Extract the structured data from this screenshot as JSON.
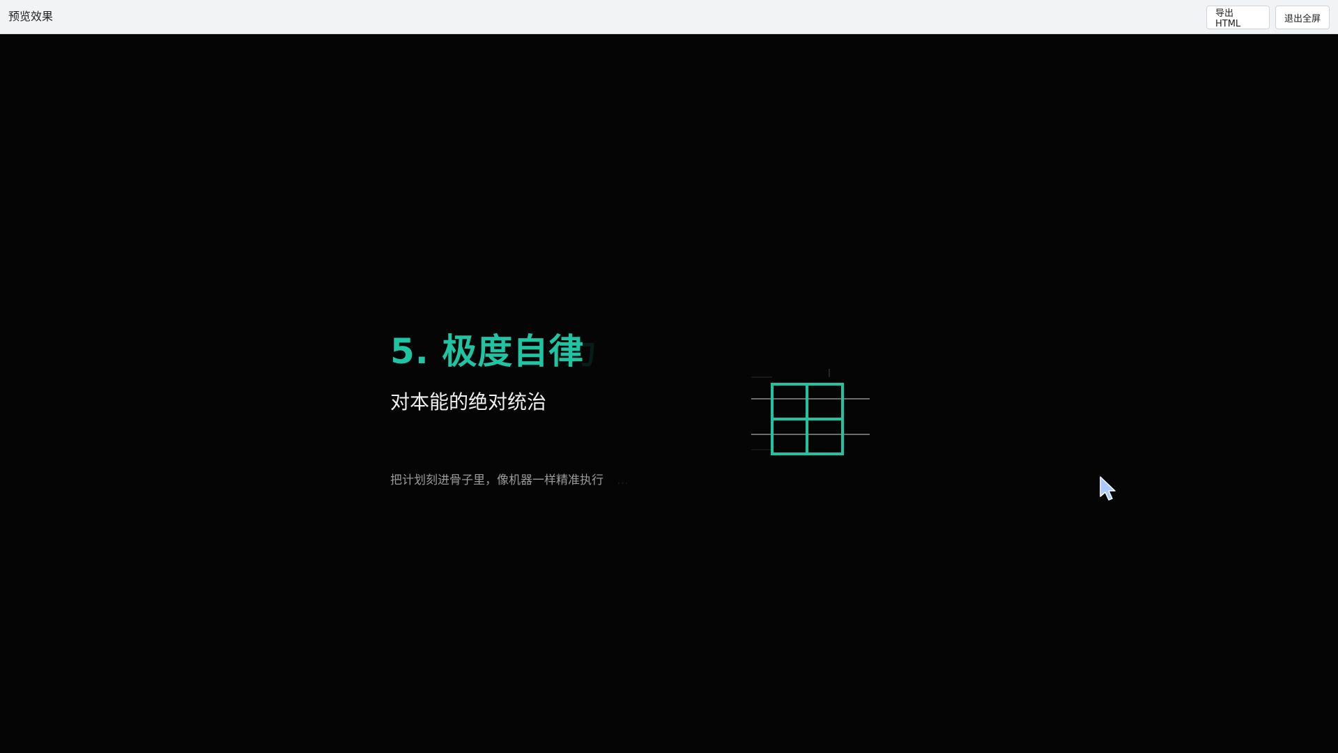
{
  "topbar": {
    "title": "预览效果",
    "export_label": "导出 HTML",
    "exit_fullscreen_label": "退出全屏"
  },
  "slide": {
    "title": "5. 极度自律",
    "title_ghost": "力",
    "subtitle": "对本能的绝对统治",
    "description": "把计划刻进骨子里，像机器一样精准执行",
    "description_ghost": "…"
  },
  "colors": {
    "accent": "#1fc4a3",
    "background": "#050505",
    "topbar_bg": "#f2f3f5",
    "subtitle": "#f0f0f0",
    "description": "#9a9a9a",
    "cursor": "#a9c9ff"
  },
  "icons": {
    "grid_graphic": "grid-table-icon",
    "cursor": "mouse-pointer-icon"
  }
}
